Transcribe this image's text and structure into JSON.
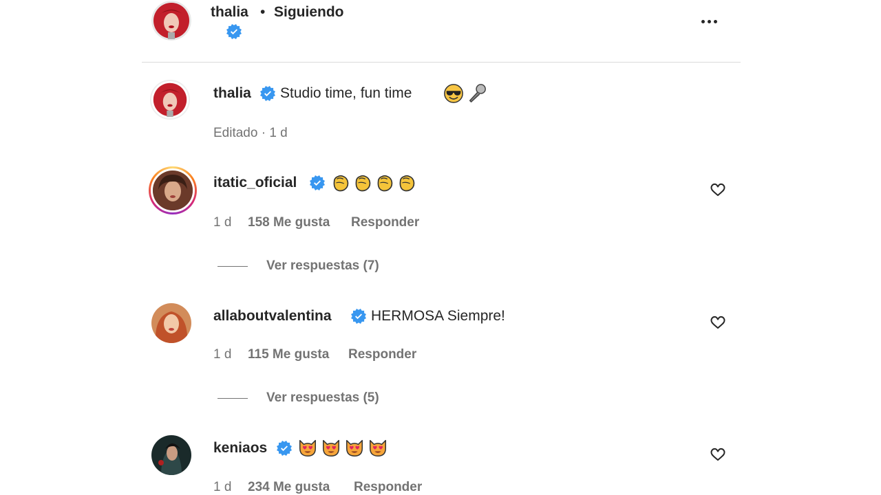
{
  "header": {
    "username": "thalia",
    "separator": "•",
    "follow_status": "Siguiendo",
    "more_icon": "more-horizontal-icon"
  },
  "caption": {
    "username": "thalia",
    "text": "Studio time, fun time",
    "emojis": [
      "sunglasses-emoji",
      "microphone-emoji"
    ],
    "meta": "Editado · 1 d"
  },
  "comments": [
    {
      "username": "itatic_oficial",
      "text": "",
      "emojis": [
        "clapping-hands-emoji",
        "clapping-hands-emoji",
        "clapping-hands-emoji",
        "clapping-hands-emoji"
      ],
      "time": "1 d",
      "likes": "158 Me gusta",
      "reply": "Responder",
      "view_replies": "Ver respuestas (7)"
    },
    {
      "username": "allaboutvalentina",
      "text": "HERMOSA Siempre!",
      "emojis": [],
      "time": "1 d",
      "likes": "115 Me gusta",
      "reply": "Responder",
      "view_replies": "Ver respuestas (5)"
    },
    {
      "username": "keniaos",
      "text": "",
      "emojis": [
        "heart-eyes-cat-emoji",
        "heart-eyes-cat-emoji",
        "heart-eyes-cat-emoji",
        "heart-eyes-cat-emoji"
      ],
      "time": "1 d",
      "likes": "234 Me gusta",
      "reply": "Responder"
    }
  ],
  "colors": {
    "verified": "#3897f0",
    "text_primary": "#262626",
    "text_secondary": "#737373",
    "divider": "#dbdbdb"
  }
}
